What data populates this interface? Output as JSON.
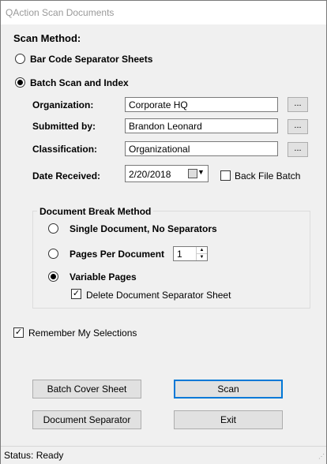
{
  "window": {
    "title": "QAction Scan Documents"
  },
  "scan_method": {
    "heading": "Scan Method:",
    "options": [
      {
        "label": "Bar Code Separator Sheets",
        "selected": false
      },
      {
        "label": "Batch Scan and Index",
        "selected": true
      }
    ]
  },
  "fields": {
    "organization": {
      "label": "Organization:",
      "value": "Corporate HQ",
      "browse": "..."
    },
    "submitted_by": {
      "label": "Submitted by:",
      "value": "Brandon Leonard",
      "browse": "..."
    },
    "classification": {
      "label": "Classification:",
      "value": "Organizational",
      "browse": "..."
    },
    "date_received": {
      "label": "Date Received:",
      "value": "2/20/2018"
    }
  },
  "back_file_batch": {
    "label": "Back File Batch",
    "checked": false
  },
  "break_method": {
    "heading": "Document Break Method",
    "options": [
      {
        "label": "Single Document, No Separators",
        "selected": false
      },
      {
        "label": "Pages Per Document",
        "selected": false
      },
      {
        "label": "Variable Pages",
        "selected": true
      }
    ],
    "pages_per_document": "1",
    "delete_separator": {
      "label": "Delete Document Separator Sheet",
      "checked": true
    }
  },
  "remember": {
    "label": "Remember My Selections",
    "checked": true
  },
  "buttons": {
    "batch_cover": "Batch Cover Sheet",
    "scan": "Scan",
    "doc_separator": "Document Separator",
    "exit": "Exit"
  },
  "status": {
    "text": "Status: Ready"
  }
}
